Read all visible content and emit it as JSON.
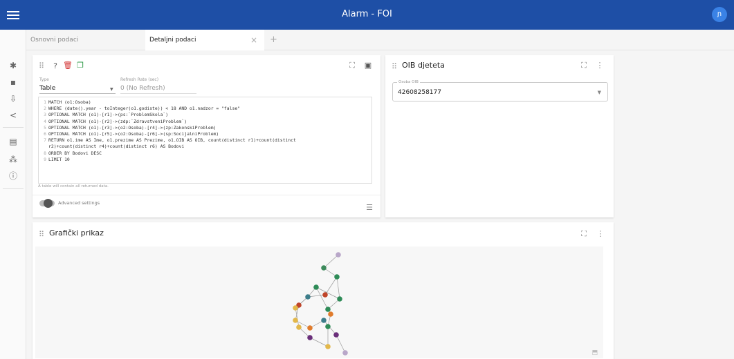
{
  "app": {
    "title": "Alarm - FOI",
    "avatar_glyph": "ɲ"
  },
  "tabs": [
    {
      "label": "Osnovni podaci",
      "active": false
    },
    {
      "label": "Detaljni podaci",
      "active": true,
      "close": "×"
    }
  ],
  "tab_add": "+",
  "left_nav": [
    {
      "icon": "gear-icon",
      "glyph": "✱"
    },
    {
      "icon": "save-icon",
      "glyph": "▪"
    },
    {
      "icon": "download-icon",
      "glyph": "⇩"
    },
    {
      "icon": "share-icon",
      "glyph": "<"
    },
    {
      "icon": "copy-icon",
      "glyph": "▤"
    },
    {
      "icon": "sitemap-icon",
      "glyph": "⁂"
    },
    {
      "icon": "info-icon",
      "glyph": "ⓘ"
    }
  ],
  "query_card": {
    "type_label": "Type",
    "type_value": "Table",
    "refresh_label": "Refresh Rate (sec)",
    "refresh_value": "0 (No Refresh)",
    "helper": "A table will contain all returned data.",
    "advanced_label": "Advanced settings",
    "query_lines": [
      {
        "n": "1",
        "text": "MATCH (o1:Osoba)"
      },
      {
        "n": "2",
        "text": "WHERE (date().year - toInteger(o1.godiste)) < 18 AND o1.nadzor = \"false\""
      },
      {
        "n": "3",
        "text": "OPTIONAL MATCH (o1)-[r1]->(ps:`ProblemSkola`)"
      },
      {
        "n": "4",
        "text": "OPTIONAL MATCH (o1)-[r2]->(zdp:`ZdravstveniProblem`)"
      },
      {
        "n": "5",
        "text": "OPTIONAL MATCH (o1)-[r3]->(o2:Osoba)-[r4]->(zp:ZakonskiProblem)"
      },
      {
        "n": "6",
        "text": "OPTIONAL MATCH (o1)-[r5]->(o2:Osoba)-[r6]->(sp:SocijalniProblem)"
      },
      {
        "n": "7",
        "text": "RETURN o1.ime AS Ime, o1.prezime AS Prezime, o1.OIB AS OIB, count(distinct r1)+count(distinct"
      },
      {
        "n": "",
        "text": "r2)+count(distinct r4)+count(distinct r6) AS Bodovi"
      },
      {
        "n": "8",
        "text": "ORDER BY Bodovi DESC"
      },
      {
        "n": "9",
        "text": "LIMIT 10"
      }
    ]
  },
  "oib_card": {
    "title": "OIB djeteta",
    "field_label": "Osoba OIB",
    "field_value": "42608258177"
  },
  "graph_card": {
    "title": "Grafički prikaz"
  },
  "colors": {
    "appbar": "#1e4fa6",
    "node_green": "#2e8b57",
    "node_purple": "#6a2f7a",
    "node_red": "#c0452a",
    "node_orange": "#e07b2c",
    "node_yellow": "#e3b84a",
    "node_teal": "#3c7d8a"
  }
}
